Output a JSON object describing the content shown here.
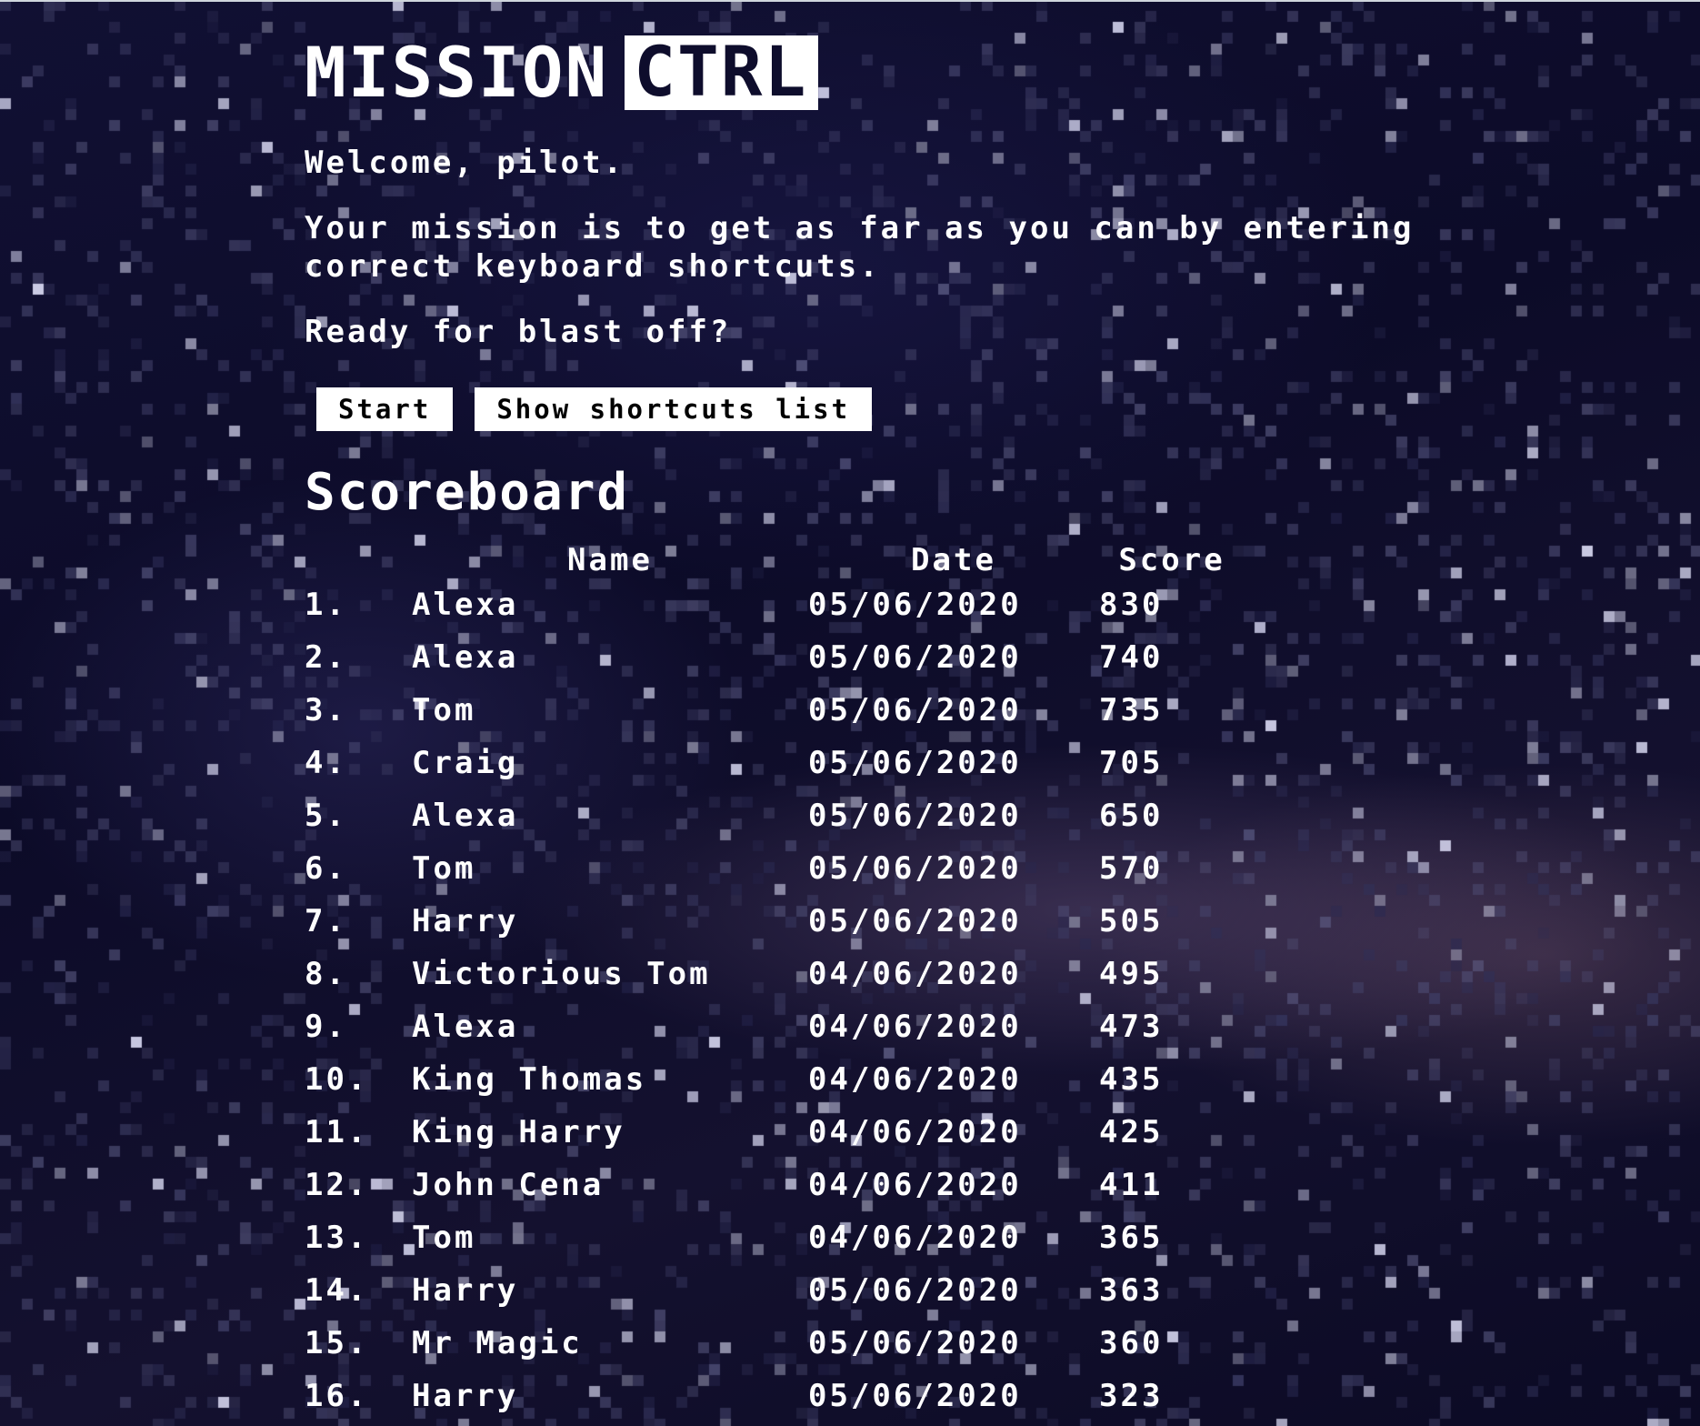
{
  "header": {
    "logo_part1": "MISSION",
    "logo_part2": "CTRL"
  },
  "intro": {
    "welcome": "Welcome, pilot.",
    "mission": "Your mission is to get as far as you can by entering correct keyboard shortcuts.",
    "ready": "Ready for blast off?"
  },
  "buttons": {
    "start": "Start",
    "show_shortcuts": "Show shortcuts list"
  },
  "scoreboard": {
    "title": "Scoreboard",
    "columns": {
      "rank": "",
      "name": "Name",
      "date": "Date",
      "score": "Score"
    },
    "rows": [
      {
        "rank": "1.",
        "name": "Alexa",
        "date": "05/06/2020",
        "score": "830"
      },
      {
        "rank": "2.",
        "name": "Alexa",
        "date": "05/06/2020",
        "score": "740"
      },
      {
        "rank": "3.",
        "name": "Tom",
        "date": "05/06/2020",
        "score": "735"
      },
      {
        "rank": "4.",
        "name": "Craig",
        "date": "05/06/2020",
        "score": "705"
      },
      {
        "rank": "5.",
        "name": "Alexa",
        "date": "05/06/2020",
        "score": "650"
      },
      {
        "rank": "6.",
        "name": "Tom",
        "date": "05/06/2020",
        "score": "570"
      },
      {
        "rank": "7.",
        "name": "Harry",
        "date": "05/06/2020",
        "score": "505"
      },
      {
        "rank": "8.",
        "name": "Victorious Tom",
        "date": "04/06/2020",
        "score": "495"
      },
      {
        "rank": "9.",
        "name": "Alexa",
        "date": "04/06/2020",
        "score": "473"
      },
      {
        "rank": "10.",
        "name": "King Thomas",
        "date": "04/06/2020",
        "score": "435"
      },
      {
        "rank": "11.",
        "name": "King Harry",
        "date": "04/06/2020",
        "score": "425"
      },
      {
        "rank": "12.",
        "name": "John Cena",
        "date": "04/06/2020",
        "score": "411"
      },
      {
        "rank": "13.",
        "name": "Tom",
        "date": "04/06/2020",
        "score": "365"
      },
      {
        "rank": "14.",
        "name": "Harry",
        "date": "05/06/2020",
        "score": "363"
      },
      {
        "rank": "15.",
        "name": "Mr Magic",
        "date": "05/06/2020",
        "score": "360"
      },
      {
        "rank": "16.",
        "name": "Harry",
        "date": "05/06/2020",
        "score": "323"
      }
    ]
  },
  "colors": {
    "background": "#0e0d2c",
    "text": "#ffffff",
    "button_bg": "#ffffff",
    "button_text": "#000000"
  }
}
